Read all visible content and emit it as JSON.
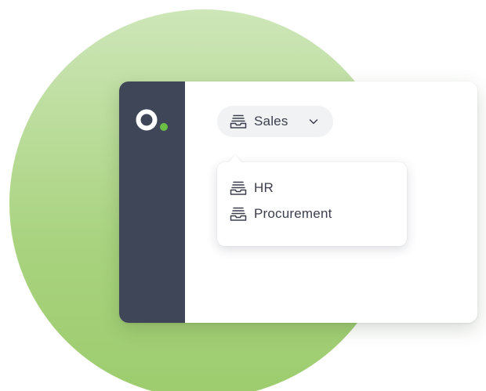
{
  "selector": {
    "current": "Sales",
    "icon": "inbox-tray-icon",
    "chevron": "chevron-down-icon"
  },
  "dropdown": {
    "items": [
      {
        "label": "HR",
        "icon": "inbox-tray-icon"
      },
      {
        "label": "Procurement",
        "icon": "inbox-tray-icon"
      }
    ]
  },
  "colors": {
    "sidebar": "#3f4657",
    "accent": "#6cbf45",
    "text": "#3a3f4b",
    "selector_bg": "#f1f2f4",
    "background_circle": "#a9d37f"
  }
}
